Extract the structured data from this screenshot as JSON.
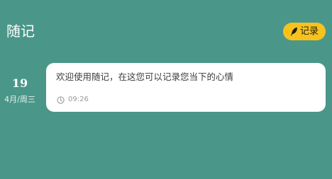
{
  "header": {
    "title": "随记",
    "record_button": {
      "label": "记录",
      "icon": "feather-icon"
    }
  },
  "colors": {
    "background": "#4a9789",
    "accent": "#f8c21c",
    "card": "#ffffff"
  },
  "entries": [
    {
      "day": "19",
      "month_weekday": "4月/周三",
      "text": "欢迎使用随记，在这您可以记录您当下的心情",
      "time": "09:26",
      "time_icon": "clock-icon"
    }
  ]
}
